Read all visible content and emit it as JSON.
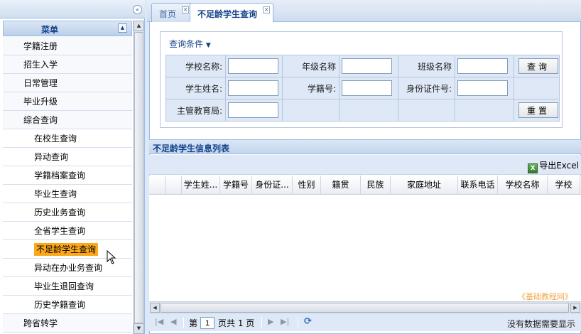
{
  "left": {
    "collapse_icon": "«",
    "menu_title": "菜单",
    "menu_up_icon": "▲",
    "items": [
      {
        "label": "学籍注册",
        "level": 1
      },
      {
        "label": "招生入学",
        "level": 1
      },
      {
        "label": "日常管理",
        "level": 1
      },
      {
        "label": "毕业升级",
        "level": 1
      },
      {
        "label": "综合查询",
        "level": 1
      },
      {
        "label": "在校生查询",
        "level": 2
      },
      {
        "label": "异动查询",
        "level": 2
      },
      {
        "label": "学籍档案查询",
        "level": 2
      },
      {
        "label": "毕业生查询",
        "level": 2
      },
      {
        "label": "历史业务查询",
        "level": 2
      },
      {
        "label": "全省学生查询",
        "level": 2
      },
      {
        "label": "不足龄学生查询",
        "level": 2,
        "selected": true
      },
      {
        "label": "异动在办业务查询",
        "level": 2
      },
      {
        "label": "毕业生退回查询",
        "level": 2
      },
      {
        "label": "历史学籍查询",
        "level": 2
      },
      {
        "label": "跨省转学",
        "level": 1
      }
    ]
  },
  "tabs": [
    {
      "label": "首页",
      "active": false
    },
    {
      "label": "不足龄学生查询",
      "active": true
    }
  ],
  "query": {
    "legend": "查询条件",
    "school_name_label": "学校名称:",
    "grade_name_label": "年级名称",
    "class_name_label": "班级名称",
    "student_name_label": "学生姓名:",
    "student_id_label": "学籍号:",
    "id_card_label": "身份证件号:",
    "edu_bureau_label": "主管教育局:",
    "search_button": "查询",
    "reset_button": "重置"
  },
  "list": {
    "title": "不足龄学生信息列表",
    "export_label": "导出Excel",
    "columns": [
      "学生姓...",
      "学籍号",
      "身份证...",
      "性别",
      "籍贯",
      "民族",
      "家庭地址",
      "联系电话",
      "学校名称",
      "学校"
    ],
    "watermark": "《基础教程网》"
  },
  "pager": {
    "page_prefix": "第",
    "page_value": "1",
    "page_suffix": "页共 1 页",
    "status": "没有数据需要显示"
  },
  "colors": {
    "selected_bg": "#fca81b",
    "header_text": "#15428b",
    "panel_bg": "#dfe8f6"
  }
}
